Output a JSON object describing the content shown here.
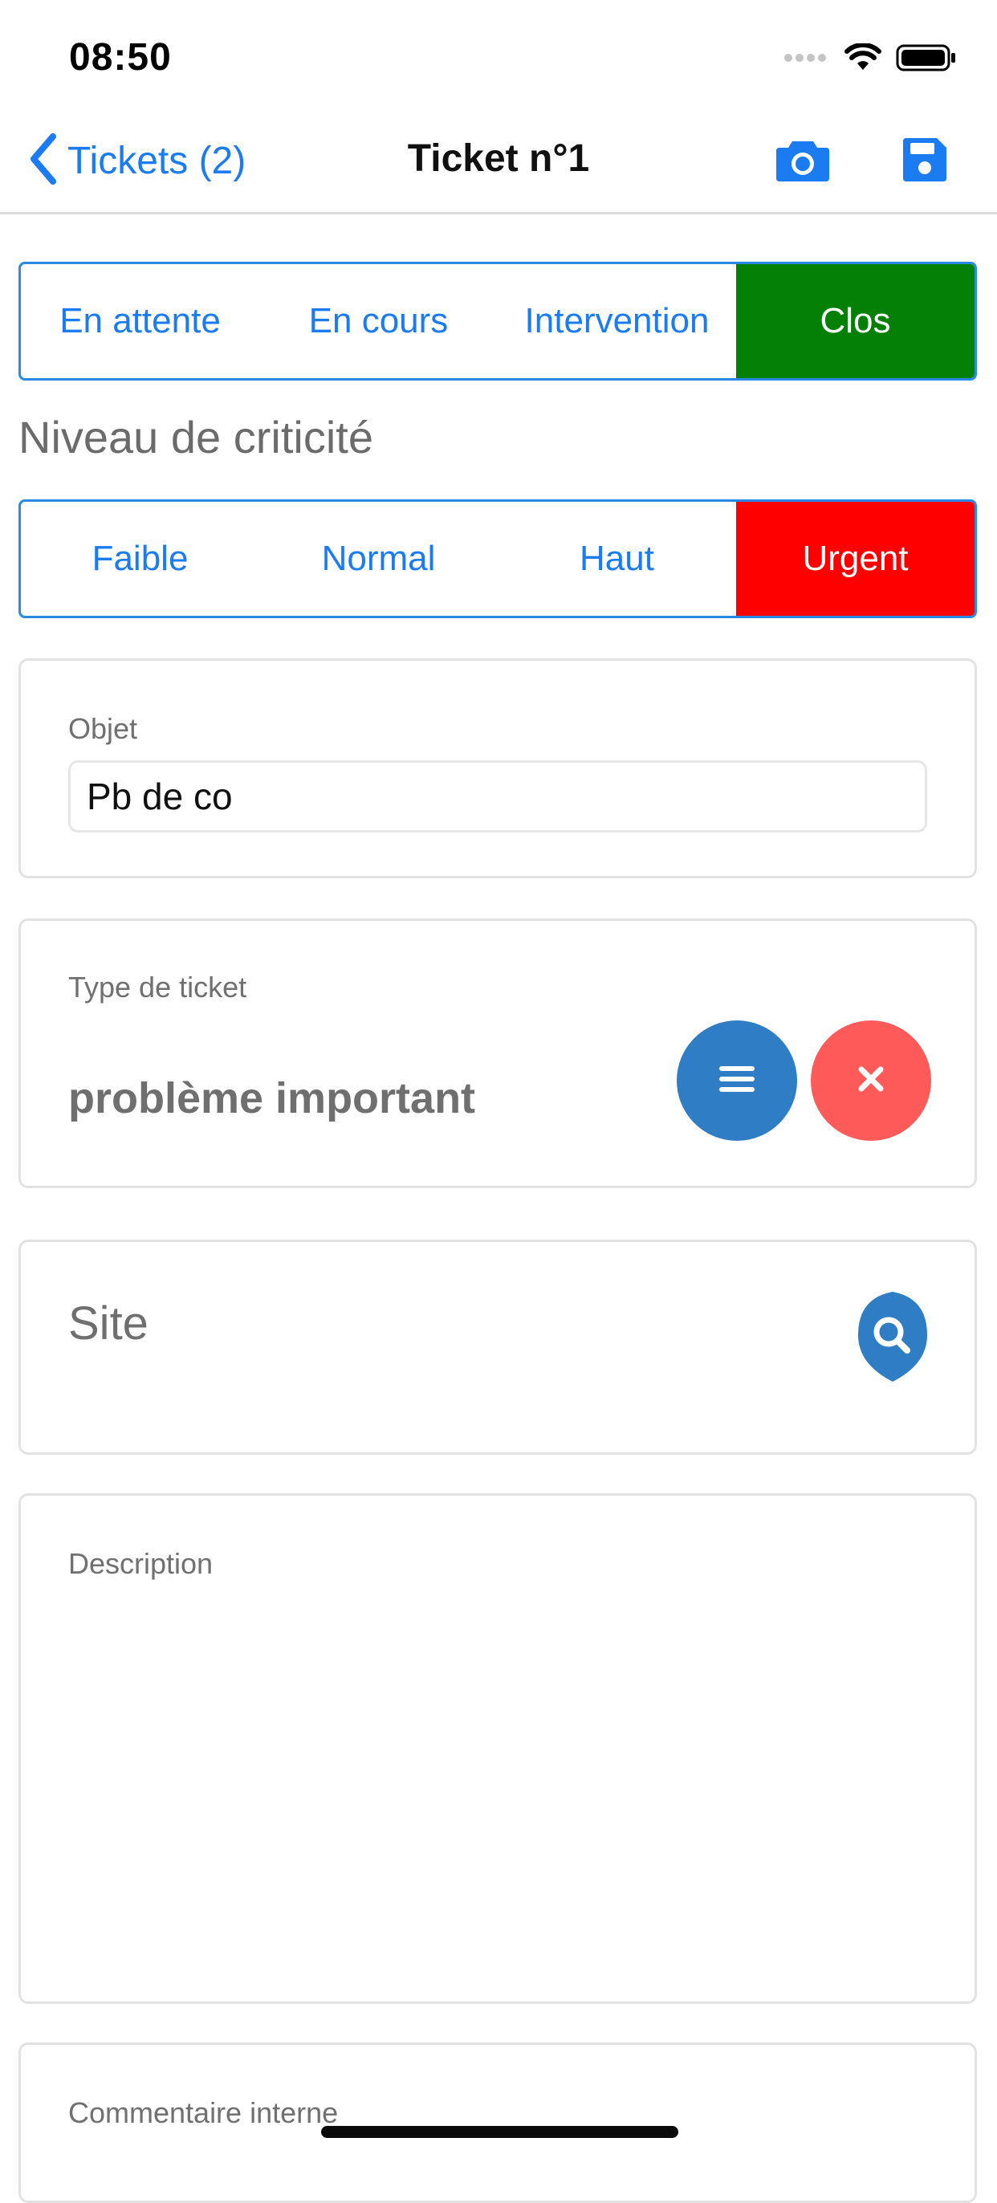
{
  "status_bar": {
    "time": "08:50",
    "icons": [
      "signal-dots-icon",
      "wifi-icon",
      "battery-icon"
    ]
  },
  "nav": {
    "back_label": "Tickets (2)",
    "title": "Ticket n°1",
    "actions": [
      "camera-icon",
      "save-icon"
    ],
    "accent_color": "#1a7cf0"
  },
  "status_segment": {
    "options": [
      "En attente",
      "En cours",
      "Intervention",
      "Clos"
    ],
    "selected": "Clos",
    "selected_color": "#048006"
  },
  "criticality": {
    "title": "Niveau de criticité",
    "options": [
      "Faible",
      "Normal",
      "Haut",
      "Urgent"
    ],
    "selected": "Urgent",
    "selected_color": "#ff0000"
  },
  "object_field": {
    "label": "Objet",
    "value": "Pb de co"
  },
  "ticket_type": {
    "label": "Type de ticket",
    "value": "problème important",
    "list_button_icon": "list-icon",
    "clear_button_icon": "close-icon",
    "list_button_color": "#2f7dc4",
    "clear_button_color": "#ff5a5a"
  },
  "site": {
    "label": "Site",
    "search_icon": "search-icon"
  },
  "description": {
    "label": "Description"
  },
  "internal_comment": {
    "label": "Commentaire interne"
  }
}
